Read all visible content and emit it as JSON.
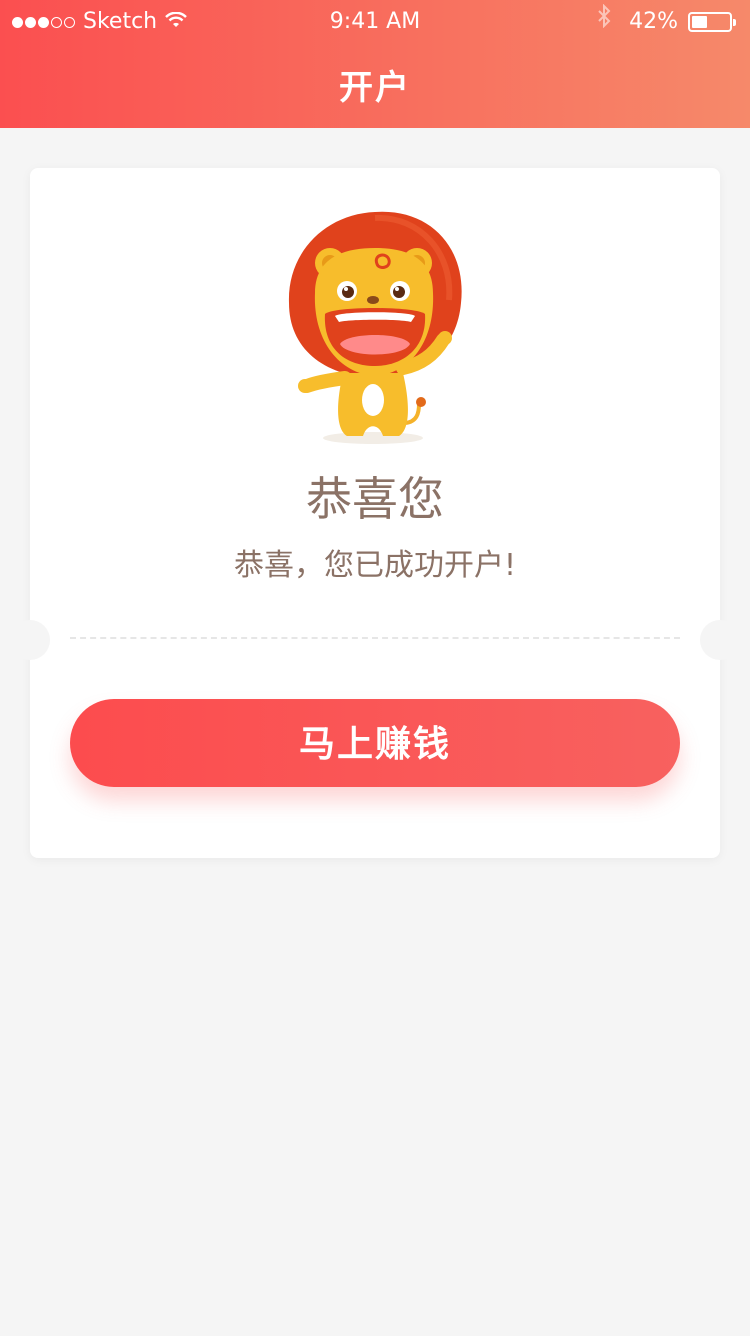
{
  "status_bar": {
    "carrier": "Sketch",
    "time": "9:41 AM",
    "battery": "42%",
    "battery_level": 0.42
  },
  "nav": {
    "title": "开户"
  },
  "card": {
    "title": "恭喜您",
    "message": "恭喜，您已成功开户!",
    "button_label": "马上赚钱"
  },
  "colors": {
    "header_gradient_start": "#fb4f50",
    "header_gradient_end": "#f6896a",
    "button": "#fc4c4e",
    "text_brown": "#8b7266",
    "background": "#f5f5f5"
  },
  "icons": [
    "signal-dots-icon",
    "wifi-icon",
    "bluetooth-icon",
    "battery-icon",
    "lion-mascot-illustration"
  ]
}
